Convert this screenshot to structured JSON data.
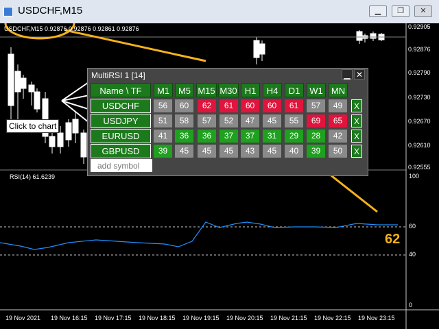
{
  "window": {
    "title": "USDCHF,M15"
  },
  "chart": {
    "info": "USDCHF,M15  0.92876 0.92876 0.92861 0.92876",
    "price_scale": [
      "0.92905",
      "0.92876",
      "0.92790",
      "0.92730",
      "0.92670",
      "0.92610",
      "0.92555"
    ],
    "rsi_label": "RSI(14) 61.6239",
    "rsi_scale": [
      "100",
      "60",
      "40",
      "0"
    ],
    "time_labels": [
      "19 Nov 2021",
      "19 Nov 16:15",
      "19 Nov 17:15",
      "19 Nov 18:15",
      "19 Nov 19:15",
      "19 Nov 20:15",
      "19 Nov 21:15",
      "19 Nov 22:15",
      "19 Nov 23:15"
    ],
    "colors": {
      "candle": "#ffffff",
      "rsi_line": "#1e90ff",
      "annotation": "#f6b21a"
    }
  },
  "panel": {
    "title": "MultiRSI 1 [14]",
    "minimize_label": "▁",
    "close_label": "✕",
    "header": "Name \\ TF",
    "timeframes": [
      "M1",
      "M5",
      "M15",
      "M30",
      "H1",
      "H4",
      "D1",
      "W1",
      "MN"
    ],
    "rows": [
      {
        "symbol": "USDCHF",
        "values": [
          "56",
          "60",
          "62",
          "61",
          "60",
          "60",
          "61",
          "57",
          "49"
        ],
        "colors": [
          "gray",
          "gray",
          "red",
          "red",
          "red",
          "red",
          "red",
          "gray",
          "gray"
        ],
        "remove": "X"
      },
      {
        "symbol": "USDJPY",
        "values": [
          "51",
          "58",
          "57",
          "52",
          "47",
          "45",
          "55",
          "69",
          "65"
        ],
        "colors": [
          "gray",
          "gray",
          "gray",
          "gray",
          "gray",
          "gray",
          "gray",
          "red",
          "red"
        ],
        "remove": "X"
      },
      {
        "symbol": "EURUSD",
        "values": [
          "41",
          "36",
          "36",
          "37",
          "37",
          "31",
          "29",
          "28",
          "42"
        ],
        "colors": [
          "gray",
          "green",
          "green",
          "green",
          "green",
          "green",
          "green",
          "green",
          "gray"
        ],
        "remove": "X"
      },
      {
        "symbol": "GBPUSD",
        "values": [
          "39",
          "45",
          "45",
          "45",
          "43",
          "45",
          "40",
          "39",
          "50"
        ],
        "colors": [
          "green",
          "gray",
          "gray",
          "gray",
          "gray",
          "gray",
          "gray",
          "green",
          "gray"
        ],
        "remove": "X"
      }
    ],
    "add_placeholder": "add symbol",
    "colors": {
      "green_button": "#1c7a1c",
      "red_cell": "#e0143c",
      "green_cell": "#1fa01f",
      "gray_cell": "#8a8a8a"
    }
  },
  "annotations": {
    "callout": "Click to chart",
    "highlight_value": "62"
  }
}
